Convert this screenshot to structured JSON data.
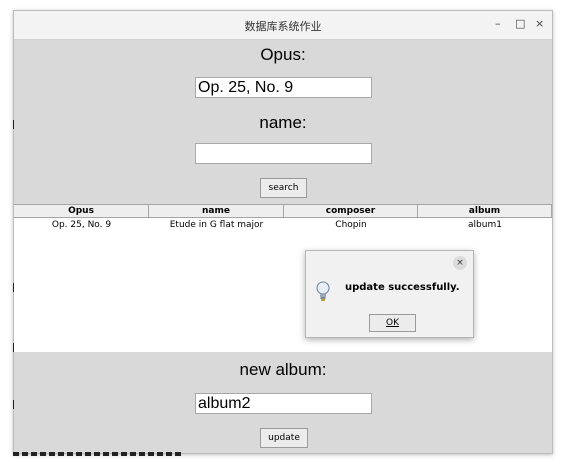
{
  "window": {
    "title": "数据库系统作业",
    "minimize": "–",
    "maximize": "□",
    "close": "×"
  },
  "form": {
    "opus_label": "Opus:",
    "opus_value": "Op. 25, No. 9",
    "name_label": "name:",
    "name_value": "",
    "search_button": "search"
  },
  "table": {
    "columns": [
      "Opus",
      "name",
      "composer",
      "album"
    ],
    "rows": [
      [
        "Op. 25, No. 9",
        "Etude in G flat major",
        "Chopin",
        "album1"
      ]
    ]
  },
  "dialog": {
    "close": "×",
    "icon": "lightbulb-icon",
    "message": "update successfully.",
    "ok_label": "OK"
  },
  "update_form": {
    "new_album_label": "new album:",
    "new_album_value": "album2",
    "update_button": "update"
  }
}
